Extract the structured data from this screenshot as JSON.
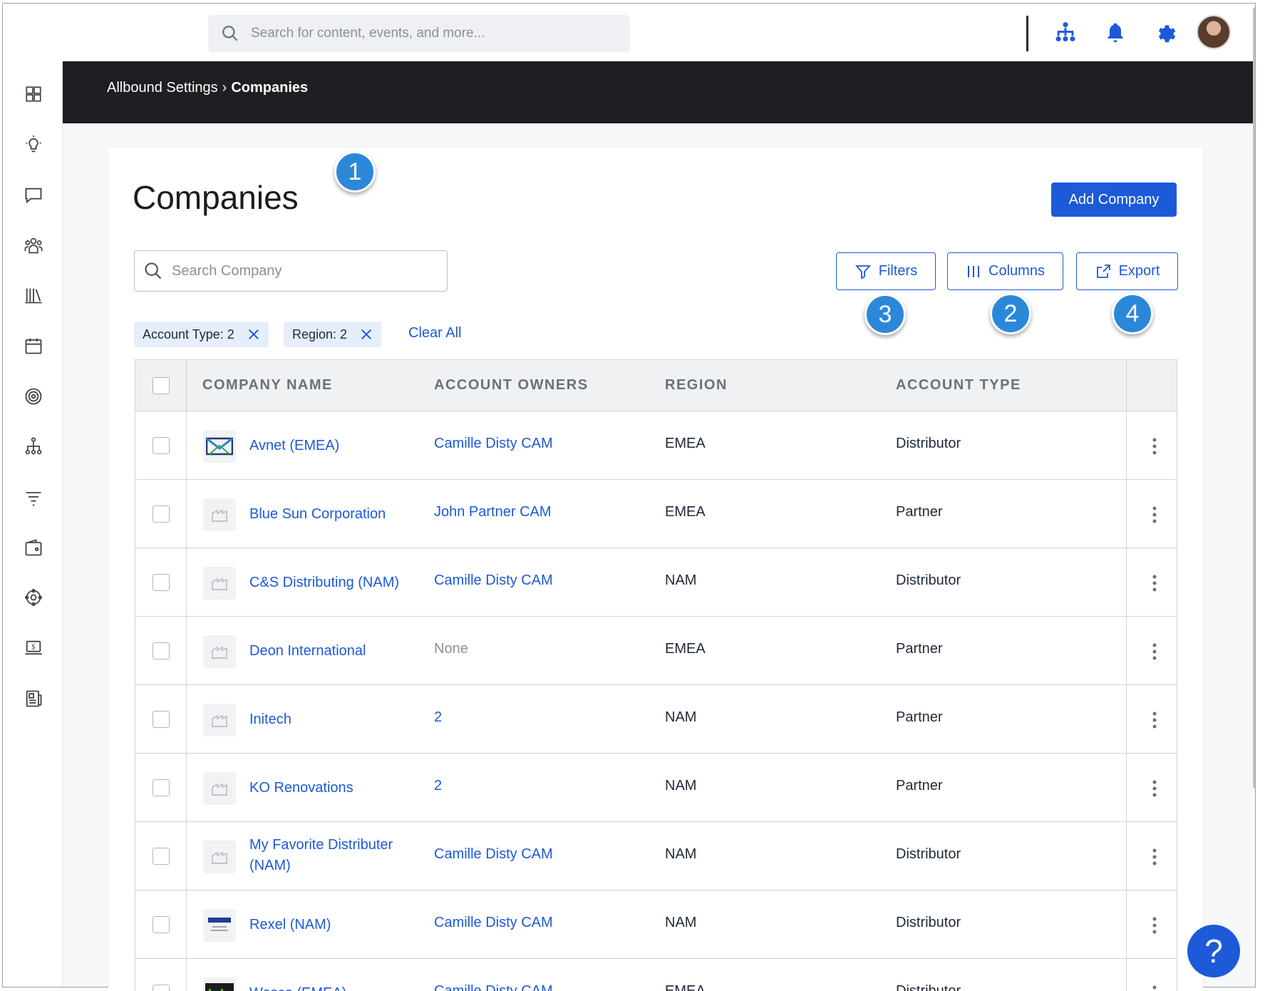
{
  "topbar": {
    "search_placeholder": "Search for content, events, and more...",
    "icons": [
      "org-chart-icon",
      "bell-icon",
      "gear-icon",
      "avatar"
    ]
  },
  "sidebar": {
    "icons": [
      "dashboard-icon",
      "lightbulb-icon",
      "chat-icon",
      "people-icon",
      "library-icon",
      "calendar-icon",
      "target-icon",
      "hierarchy-icon",
      "filter-lines-icon",
      "wallet-icon",
      "network-icon",
      "laptop-dollar-icon",
      "newspaper-icon"
    ]
  },
  "breadcrumb": {
    "parent": "Allbound Settings",
    "separator": "›",
    "current": "Companies"
  },
  "page": {
    "title": "Companies",
    "add_button": "Add Company",
    "search_placeholder": "Search Company",
    "filters_button": "Filters",
    "columns_button": "Columns",
    "export_button": "Export",
    "chips": [
      {
        "label": "Account Type: 2"
      },
      {
        "label": "Region: 2"
      }
    ],
    "clear_all": "Clear All"
  },
  "callouts": [
    "1",
    "3",
    "2",
    "4"
  ],
  "table": {
    "headers": [
      "COMPANY NAME",
      "ACCOUNT OWNERS",
      "REGION",
      "ACCOUNT TYPE"
    ],
    "rows": [
      {
        "name": "Avnet (EMEA)",
        "owner": "Camille Disty CAM",
        "region": "EMEA",
        "type": "Distributor",
        "logo": "avnet-logo"
      },
      {
        "name": "Blue Sun Corporation",
        "owner": "John Partner CAM",
        "region": "EMEA",
        "type": "Partner",
        "logo": "placeholder-logo"
      },
      {
        "name": "C&S Distributing (NAM)",
        "owner": "Camille Disty CAM",
        "region": "NAM",
        "type": "Distributor",
        "logo": "placeholder-logo"
      },
      {
        "name": "Deon International",
        "owner": "None",
        "region": "EMEA",
        "type": "Partner",
        "logo": "placeholder-logo"
      },
      {
        "name": "Initech",
        "owner": "2",
        "region": "NAM",
        "type": "Partner",
        "logo": "placeholder-logo"
      },
      {
        "name": "KO Renovations",
        "owner": "2",
        "region": "NAM",
        "type": "Partner",
        "logo": "placeholder-logo"
      },
      {
        "name": "My Favorite Distributer (NAM)",
        "owner": "Camille Disty CAM",
        "region": "NAM",
        "type": "Distributor",
        "logo": "placeholder-logo"
      },
      {
        "name": "Rexel (NAM)",
        "owner": "Camille Disty CAM",
        "region": "NAM",
        "type": "Distributor",
        "logo": "rexel-logo"
      },
      {
        "name": "Wesco (EMEA)",
        "owner": "Camille Disty CAM",
        "region": "EMEA",
        "type": "Distributor",
        "logo": "wesco-logo"
      }
    ]
  },
  "help": {
    "label": "?"
  },
  "colors": {
    "accent": "#1c5ad8",
    "header_band": "#1d1f22",
    "callout": "#2b88d9"
  }
}
